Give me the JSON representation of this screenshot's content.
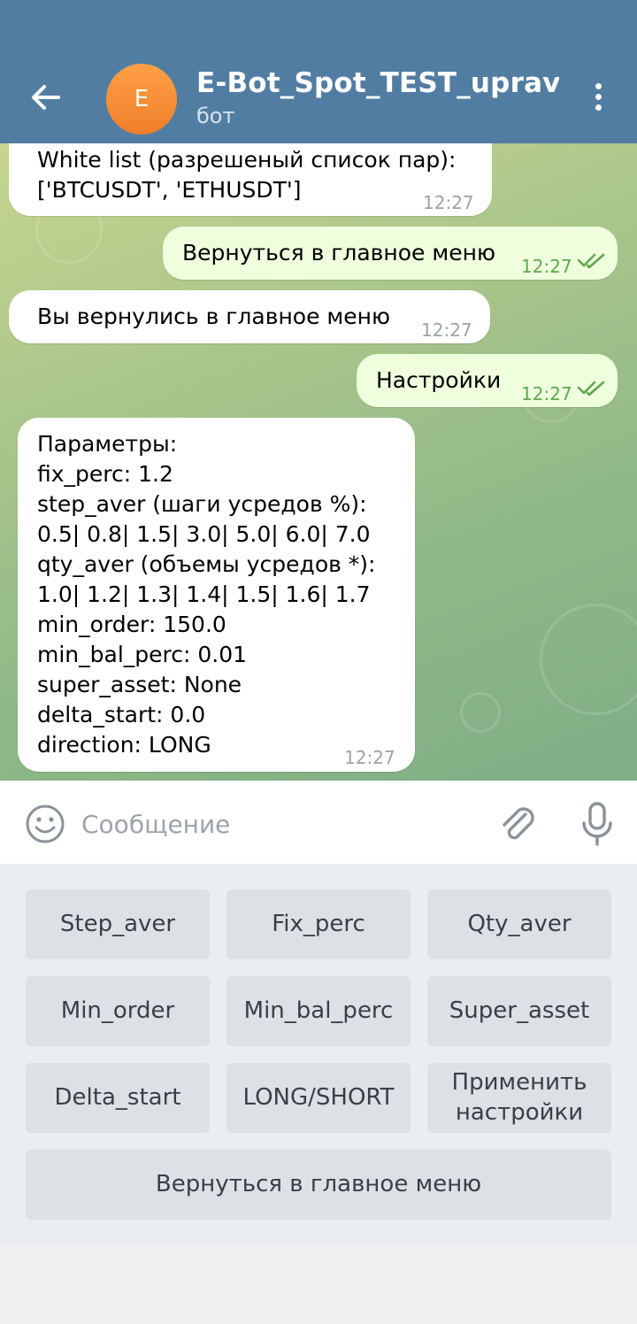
{
  "header": {
    "title": "E-Bot_Spot_TEST_uprav_bot",
    "subtitle": "бот",
    "avatar_letter": "E",
    "avatar_color": "#f58a36",
    "bar_color": "#527da3"
  },
  "messages": [
    {
      "direction": "in",
      "text": "White list (разрешеный список пар):\n['BTCUSDT', 'ETHUSDT']",
      "time": "12:27"
    },
    {
      "direction": "out",
      "text": "Вернуться в главное меню",
      "time": "12:27",
      "read": true
    },
    {
      "direction": "in",
      "text": "Вы вернулись в главное меню",
      "time": "12:27"
    },
    {
      "direction": "out",
      "text": "Настройки",
      "time": "12:27",
      "read": true
    },
    {
      "direction": "in",
      "text": "Параметры:\nfix_perc: 1.2\nstep_aver (шаги усредов %):\n0.5| 0.8| 1.5| 3.0| 5.0| 6.0| 7.0\nqty_aver (объемы усредов *):\n1.0| 1.2| 1.3| 1.4| 1.5| 1.6| 1.7\nmin_order: 150.0\nmin_bal_perc: 0.01\nsuper_asset: None\ndelta_start: 0.0\ndirection: LONG",
      "time": "12:27"
    }
  ],
  "composer": {
    "placeholder": "Сообщение",
    "icons": [
      "smile-icon",
      "paperclip-icon",
      "microphone-icon"
    ]
  },
  "keyboard": {
    "buttons": [
      "Step_aver",
      "Fix_perc",
      "Qty_aver",
      "Min_order",
      "Min_bal_perc",
      "Super_asset",
      "Delta_start",
      "LONG/SHORT",
      "Применить\nнастройки",
      "Вернуться в главное меню"
    ]
  }
}
